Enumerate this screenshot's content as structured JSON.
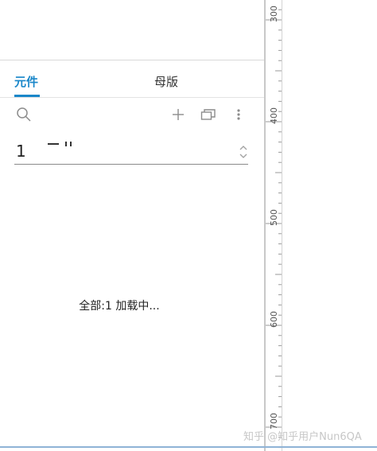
{
  "tabs": {
    "components_label": "元件",
    "masters_label": "母版"
  },
  "toolbar": {
    "search_icon": "search-icon",
    "add_icon": "plus-icon",
    "duplicate_icon": "duplicate-icon",
    "more_icon": "more-vertical-icon"
  },
  "library_select": {
    "value": "1"
  },
  "status": {
    "loading_text": "全部:1 加载中..."
  },
  "ruler": {
    "labels": [
      "300",
      "400",
      "500",
      "600",
      "700"
    ]
  },
  "watermark": "知乎 @知乎用户Nun6QA",
  "colors": {
    "accent": "#1a87c9",
    "divider": "#c8c8c8",
    "text": "#333333"
  }
}
